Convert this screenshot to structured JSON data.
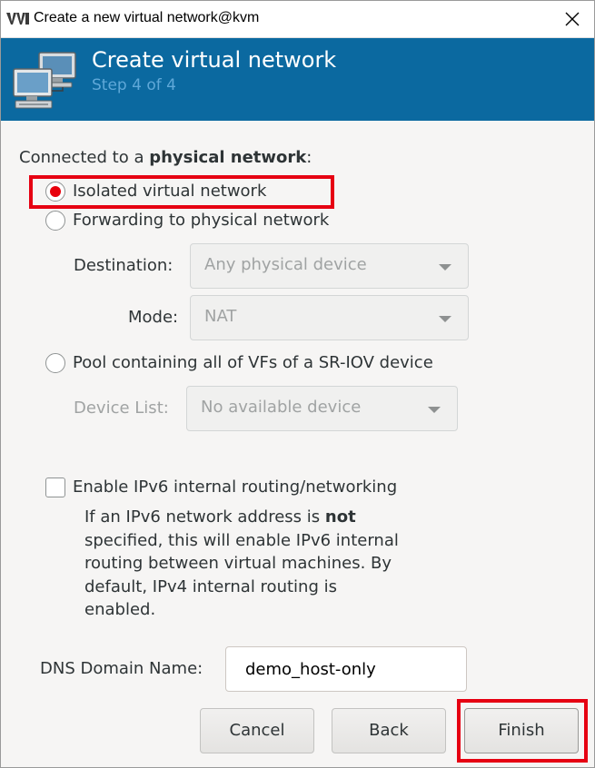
{
  "window": {
    "title": "Create a new virtual network@kvm",
    "app_icon": "virt-manager-icon",
    "close_icon": "close-icon"
  },
  "header": {
    "title": "Create virtual network",
    "step": "Step 4 of 4",
    "icon": "network-computers-icon",
    "background_color": "#0b69a0"
  },
  "connection": {
    "heading_prefix": "Connected to a ",
    "heading_bold": "physical network",
    "heading_suffix": ":",
    "options": [
      {
        "label": "Isolated virtual network",
        "checked": true
      },
      {
        "label": "Forwarding to physical network",
        "checked": false
      },
      {
        "label": "Pool containing all of VFs of a SR-IOV device",
        "checked": false
      }
    ],
    "destination_label": "Destination:",
    "destination_value": "Any physical device",
    "mode_label": "Mode:",
    "mode_value": "NAT",
    "device_list_label": "Device List:",
    "device_list_value": "No available device"
  },
  "ipv6": {
    "label": "Enable IPv6 internal routing/networking",
    "checked": false,
    "desc_1": "If an IPv6 network address is ",
    "desc_bold": "not",
    "desc_2": " specified, this will enable IPv6 internal routing between virtual machines.  By default, IPv4 internal routing is enabled."
  },
  "dns": {
    "label": "DNS Domain Name:",
    "value": "demo_host-only"
  },
  "buttons": {
    "cancel": "Cancel",
    "back": "Back",
    "finish": "Finish"
  },
  "highlight_color": "#e60012"
}
